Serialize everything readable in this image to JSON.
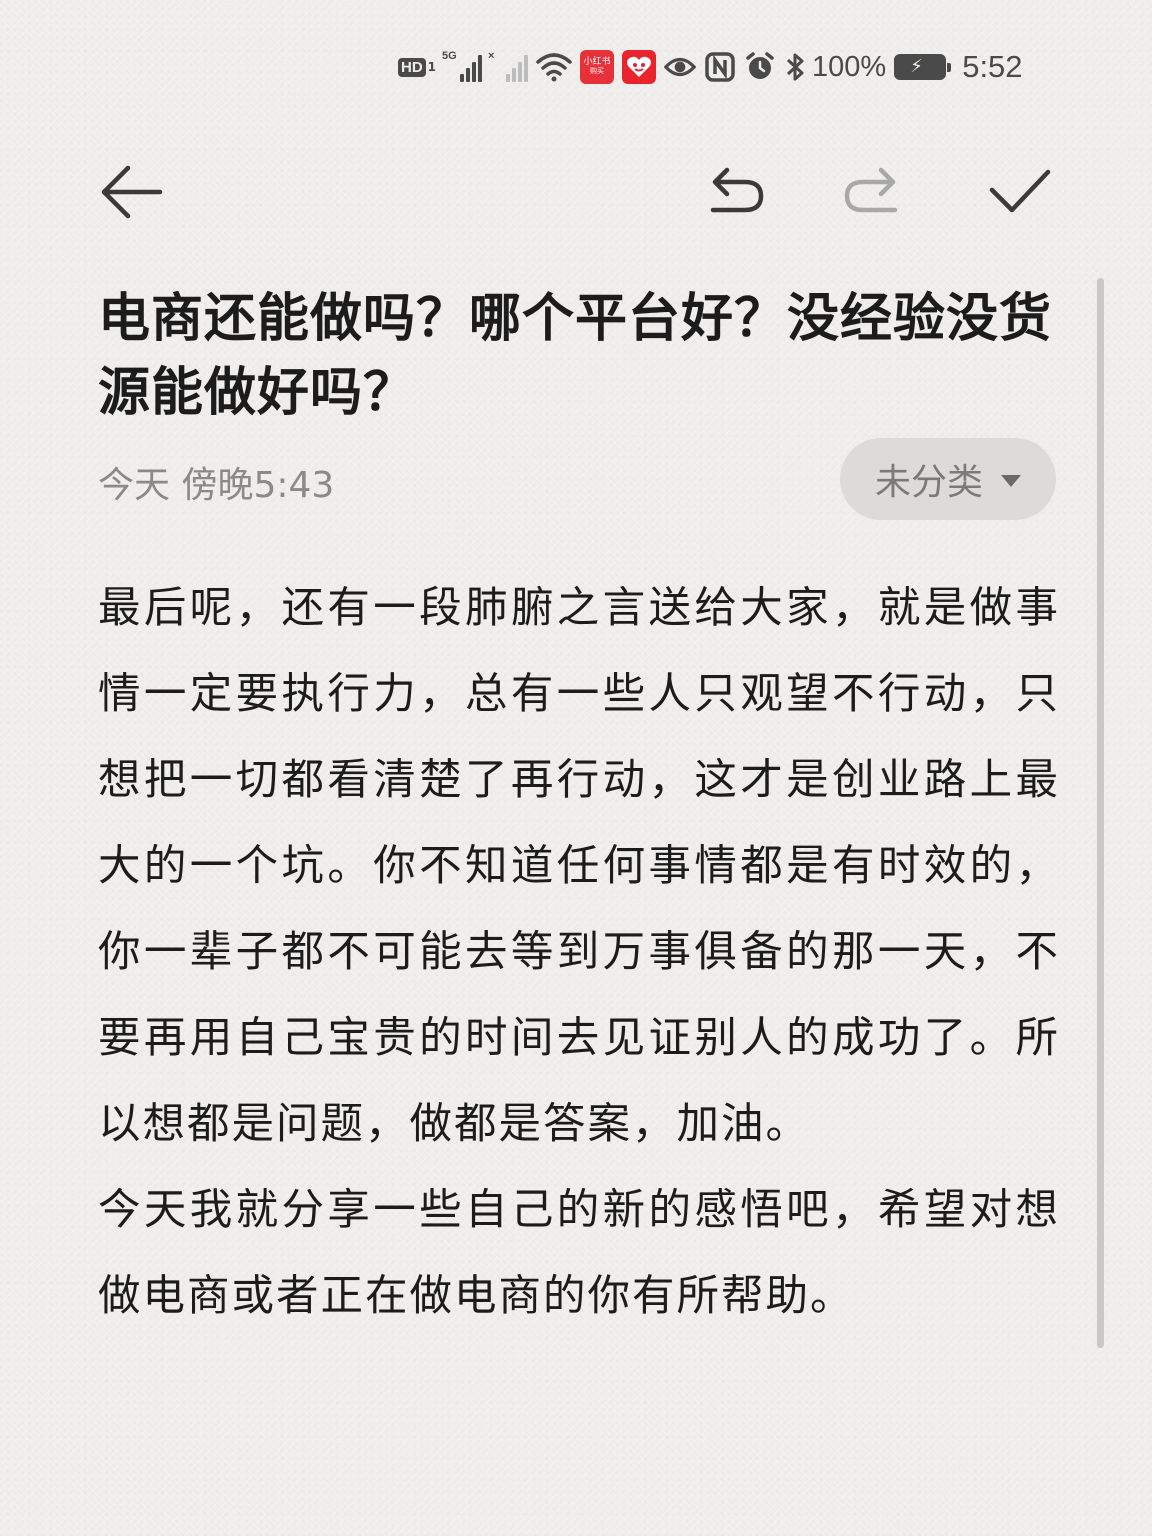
{
  "status_bar": {
    "hd_label": "HD",
    "hd_sim": "1",
    "network_label": "5G",
    "sim2_label": "×",
    "app1_label_top": "小红书",
    "app1_label_bottom": "购买",
    "battery_percent": "100%",
    "time": "5:52",
    "icons": [
      "hd-icon",
      "signal-5g-icon",
      "signal-sim2-icon",
      "wifi-icon",
      "xiaohongshu-app-icon",
      "pinduoduo-app-icon",
      "eye-icon",
      "nfc-icon",
      "alarm-icon",
      "bluetooth-icon",
      "battery-charging-icon"
    ]
  },
  "toolbar": {
    "back_icon": "arrow-left-icon",
    "undo_icon": "undo-icon",
    "redo_icon": "redo-icon",
    "done_icon": "check-icon",
    "redo_enabled": false
  },
  "note": {
    "title": "电商还能做吗？哪个平台好？没经验没货源能做好吗？",
    "timestamp": "今天 傍晚5:43",
    "category": "未分类",
    "paragraphs": [
      "最后呢，还有一段肺腑之言送给大家，就是做事情一定要执行力，总有一些人只观望不行动，只想把一切都看清楚了再行动，这才是创业路上最大的一个坑。你不知道任何事情都是有时效的，你一辈子都不可能去等到万事俱备的那一天，不要再用自己宝贵的时间去见证别人的成功了。所以想都是问题，做都是答案，加油。",
      "今天我就分享一些自己的新的感悟吧，希望对想做电商或者正在做电商的你有所帮助。"
    ]
  },
  "colors": {
    "background": "#efeeec",
    "text": "#1c1c1c",
    "meta_text": "#8a8a8a",
    "chip_bg": "#dcdbd9",
    "icon": "#3a3a3a",
    "icon_disabled": "#a8a8a8",
    "app_red": "#e8303a"
  }
}
